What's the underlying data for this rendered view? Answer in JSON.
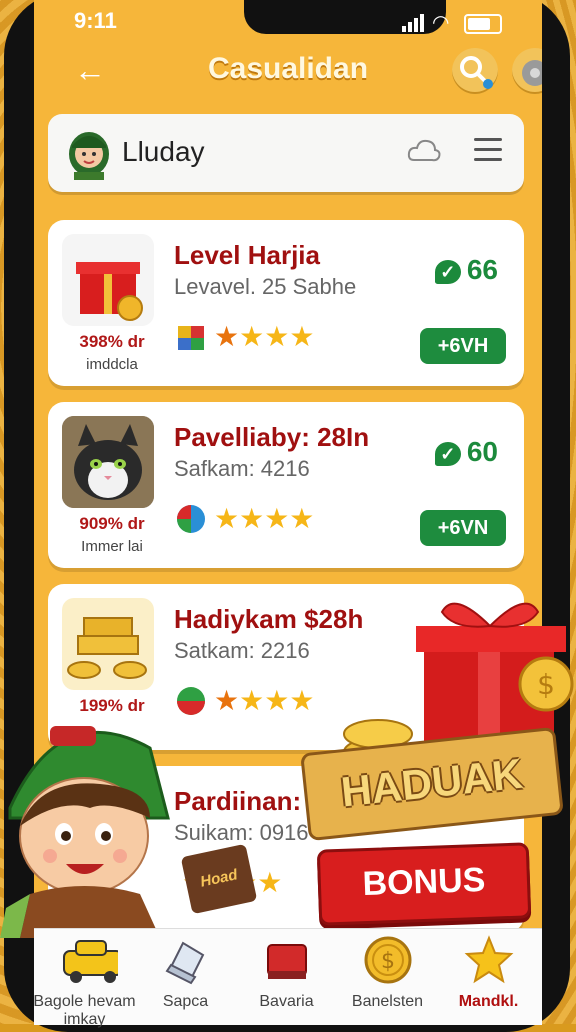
{
  "status": {
    "time": "9:11"
  },
  "header": {
    "title": "Casualidan"
  },
  "user": {
    "name": "Lluday"
  },
  "cards": [
    {
      "title": "Level Harjia",
      "desc": "Levavel. 25 Sabhe",
      "score": "66",
      "badge": "+6VH",
      "stat": "398% dr",
      "sub": "imddcla",
      "rating": 4
    },
    {
      "title": "Pavelliaby: 28In",
      "desc": "Safkam: 4216",
      "score": "60",
      "badge": "+6VN",
      "stat": "909% dr",
      "sub": "Immer lai",
      "rating": 4
    },
    {
      "title": "Hadiykam $28h",
      "desc": "Satkam: 2216",
      "stat": "199% dr",
      "rating": 4
    },
    {
      "title": "Pardiinan: a",
      "desc": "Suikam: 0916"
    }
  ],
  "promo": {
    "title": "HADUAK",
    "bonus": "BONUS",
    "card_text": "Hoad"
  },
  "nav": [
    {
      "label": "Bagole hevam imkay",
      "icon": "taxi-icon"
    },
    {
      "label": "Sapca",
      "icon": "laptop-icon"
    },
    {
      "label": "Bavaria",
      "icon": "ticket-icon"
    },
    {
      "label": "Banelsten",
      "icon": "coin-icon"
    },
    {
      "label": "Mandkl.",
      "icon": "star-icon",
      "active": true
    }
  ],
  "colors": {
    "background": "#f6b63a",
    "accent_red": "#a01010",
    "accent_green": "#1c8a3c"
  }
}
